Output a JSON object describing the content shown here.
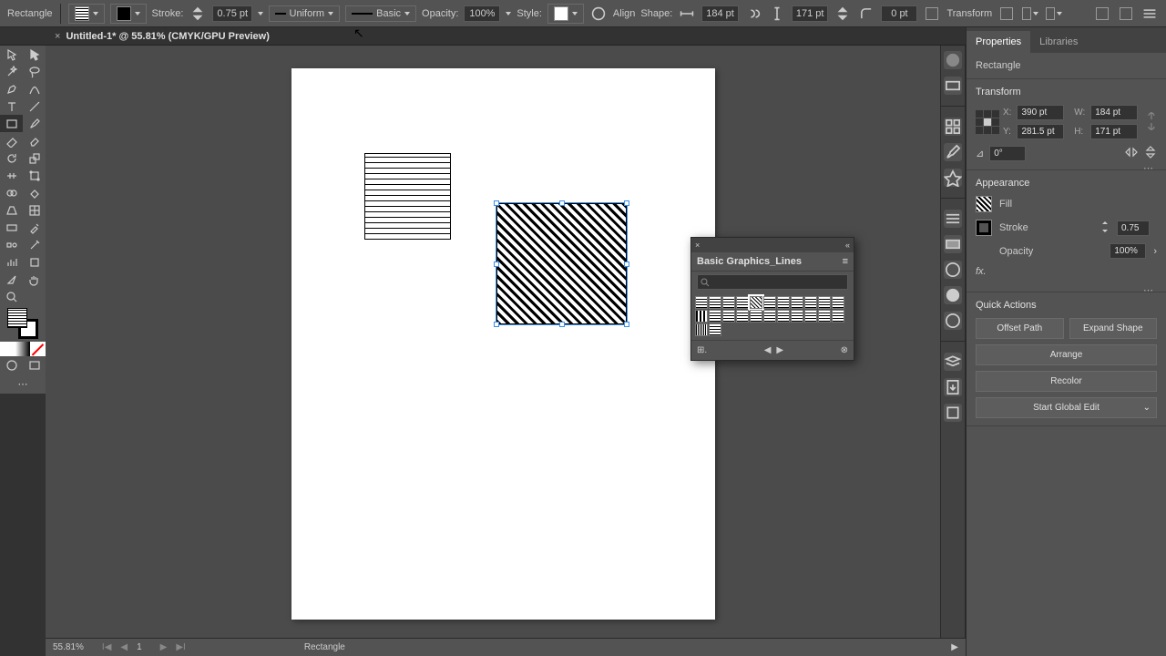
{
  "topbar": {
    "selection_type": "Rectangle",
    "stroke_label": "Stroke:",
    "stroke_weight": "0.75 pt",
    "stroke_style": "Uniform",
    "brush": "Basic",
    "opacity_label": "Opacity:",
    "opacity_value": "100%",
    "style_label": "Style:",
    "align_label": "Align",
    "shape_label": "Shape:",
    "shape_w": "184 pt",
    "shape_h": "171 pt",
    "corner": "0 pt",
    "transform_label": "Transform"
  },
  "doc": {
    "title": "Untitled-1* @ 55.81% (CMYK/GPU Preview)"
  },
  "swatch_panel": {
    "title": "Basic Graphics_Lines",
    "search_placeholder": ""
  },
  "props": {
    "tab_properties": "Properties",
    "tab_libraries": "Libraries",
    "obj_type": "Rectangle",
    "transform_title": "Transform",
    "x": "390 pt",
    "y": "281.5 pt",
    "w": "184 pt",
    "h": "171 pt",
    "angle": "0°",
    "appearance_title": "Appearance",
    "fill_label": "Fill",
    "stroke_label": "Stroke",
    "stroke_val": "0.75",
    "opacity_label": "Opacity",
    "opacity_val": "100%",
    "qa_title": "Quick Actions",
    "qa_offset": "Offset Path",
    "qa_expand": "Expand Shape",
    "qa_arrange": "Arrange",
    "qa_recolor": "Recolor",
    "qa_global": "Start Global Edit"
  },
  "status": {
    "zoom": "55.81%",
    "artboard": "1",
    "selection": "Rectangle"
  }
}
